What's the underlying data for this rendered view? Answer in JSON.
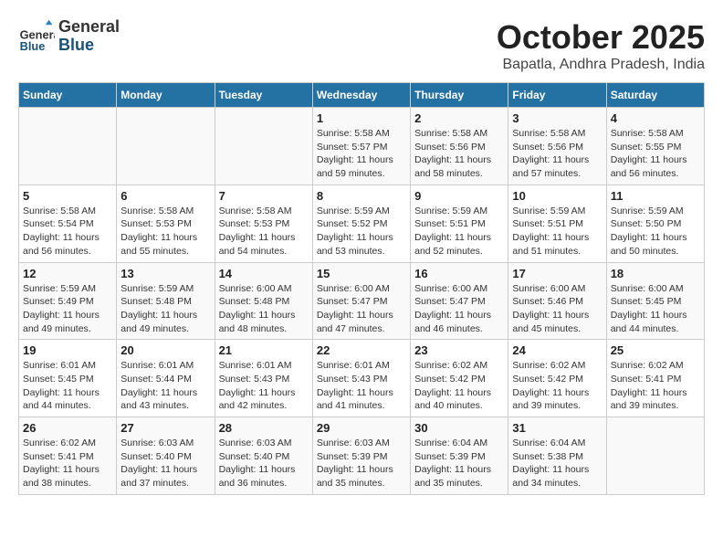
{
  "header": {
    "logo": {
      "line1": "General",
      "line2": "Blue"
    },
    "title": "October 2025",
    "subtitle": "Bapatla, Andhra Pradesh, India"
  },
  "calendar": {
    "weekdays": [
      "Sunday",
      "Monday",
      "Tuesday",
      "Wednesday",
      "Thursday",
      "Friday",
      "Saturday"
    ],
    "weeks": [
      [
        {
          "date": "",
          "info": ""
        },
        {
          "date": "",
          "info": ""
        },
        {
          "date": "",
          "info": ""
        },
        {
          "date": "1",
          "info": "Sunrise: 5:58 AM\nSunset: 5:57 PM\nDaylight: 11 hours\nand 59 minutes."
        },
        {
          "date": "2",
          "info": "Sunrise: 5:58 AM\nSunset: 5:56 PM\nDaylight: 11 hours\nand 58 minutes."
        },
        {
          "date": "3",
          "info": "Sunrise: 5:58 AM\nSunset: 5:56 PM\nDaylight: 11 hours\nand 57 minutes."
        },
        {
          "date": "4",
          "info": "Sunrise: 5:58 AM\nSunset: 5:55 PM\nDaylight: 11 hours\nand 56 minutes."
        }
      ],
      [
        {
          "date": "5",
          "info": "Sunrise: 5:58 AM\nSunset: 5:54 PM\nDaylight: 11 hours\nand 56 minutes."
        },
        {
          "date": "6",
          "info": "Sunrise: 5:58 AM\nSunset: 5:53 PM\nDaylight: 11 hours\nand 55 minutes."
        },
        {
          "date": "7",
          "info": "Sunrise: 5:58 AM\nSunset: 5:53 PM\nDaylight: 11 hours\nand 54 minutes."
        },
        {
          "date": "8",
          "info": "Sunrise: 5:59 AM\nSunset: 5:52 PM\nDaylight: 11 hours\nand 53 minutes."
        },
        {
          "date": "9",
          "info": "Sunrise: 5:59 AM\nSunset: 5:51 PM\nDaylight: 11 hours\nand 52 minutes."
        },
        {
          "date": "10",
          "info": "Sunrise: 5:59 AM\nSunset: 5:51 PM\nDaylight: 11 hours\nand 51 minutes."
        },
        {
          "date": "11",
          "info": "Sunrise: 5:59 AM\nSunset: 5:50 PM\nDaylight: 11 hours\nand 50 minutes."
        }
      ],
      [
        {
          "date": "12",
          "info": "Sunrise: 5:59 AM\nSunset: 5:49 PM\nDaylight: 11 hours\nand 49 minutes."
        },
        {
          "date": "13",
          "info": "Sunrise: 5:59 AM\nSunset: 5:48 PM\nDaylight: 11 hours\nand 49 minutes."
        },
        {
          "date": "14",
          "info": "Sunrise: 6:00 AM\nSunset: 5:48 PM\nDaylight: 11 hours\nand 48 minutes."
        },
        {
          "date": "15",
          "info": "Sunrise: 6:00 AM\nSunset: 5:47 PM\nDaylight: 11 hours\nand 47 minutes."
        },
        {
          "date": "16",
          "info": "Sunrise: 6:00 AM\nSunset: 5:47 PM\nDaylight: 11 hours\nand 46 minutes."
        },
        {
          "date": "17",
          "info": "Sunrise: 6:00 AM\nSunset: 5:46 PM\nDaylight: 11 hours\nand 45 minutes."
        },
        {
          "date": "18",
          "info": "Sunrise: 6:00 AM\nSunset: 5:45 PM\nDaylight: 11 hours\nand 44 minutes."
        }
      ],
      [
        {
          "date": "19",
          "info": "Sunrise: 6:01 AM\nSunset: 5:45 PM\nDaylight: 11 hours\nand 44 minutes."
        },
        {
          "date": "20",
          "info": "Sunrise: 6:01 AM\nSunset: 5:44 PM\nDaylight: 11 hours\nand 43 minutes."
        },
        {
          "date": "21",
          "info": "Sunrise: 6:01 AM\nSunset: 5:43 PM\nDaylight: 11 hours\nand 42 minutes."
        },
        {
          "date": "22",
          "info": "Sunrise: 6:01 AM\nSunset: 5:43 PM\nDaylight: 11 hours\nand 41 minutes."
        },
        {
          "date": "23",
          "info": "Sunrise: 6:02 AM\nSunset: 5:42 PM\nDaylight: 11 hours\nand 40 minutes."
        },
        {
          "date": "24",
          "info": "Sunrise: 6:02 AM\nSunset: 5:42 PM\nDaylight: 11 hours\nand 39 minutes."
        },
        {
          "date": "25",
          "info": "Sunrise: 6:02 AM\nSunset: 5:41 PM\nDaylight: 11 hours\nand 39 minutes."
        }
      ],
      [
        {
          "date": "26",
          "info": "Sunrise: 6:02 AM\nSunset: 5:41 PM\nDaylight: 11 hours\nand 38 minutes."
        },
        {
          "date": "27",
          "info": "Sunrise: 6:03 AM\nSunset: 5:40 PM\nDaylight: 11 hours\nand 37 minutes."
        },
        {
          "date": "28",
          "info": "Sunrise: 6:03 AM\nSunset: 5:40 PM\nDaylight: 11 hours\nand 36 minutes."
        },
        {
          "date": "29",
          "info": "Sunrise: 6:03 AM\nSunset: 5:39 PM\nDaylight: 11 hours\nand 35 minutes."
        },
        {
          "date": "30",
          "info": "Sunrise: 6:04 AM\nSunset: 5:39 PM\nDaylight: 11 hours\nand 35 minutes."
        },
        {
          "date": "31",
          "info": "Sunrise: 6:04 AM\nSunset: 5:38 PM\nDaylight: 11 hours\nand 34 minutes."
        },
        {
          "date": "",
          "info": ""
        }
      ]
    ]
  }
}
